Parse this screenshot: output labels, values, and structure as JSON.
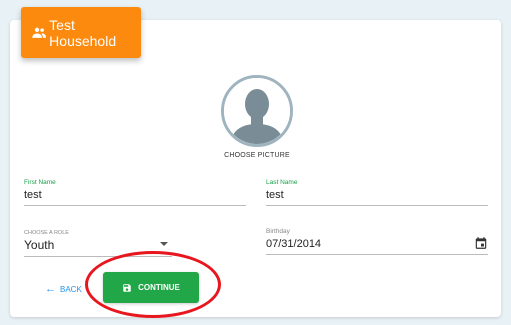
{
  "header": {
    "title": "Test Household",
    "icon": "group-icon",
    "color": "#fb8a0e"
  },
  "avatar": {
    "choose_label": "CHOOSE PICTURE"
  },
  "form": {
    "first_name": {
      "label": "First Name",
      "value": "test"
    },
    "last_name": {
      "label": "Last Name",
      "value": "test"
    },
    "role": {
      "label": "CHOOSE A ROLE",
      "value": "Youth"
    },
    "birthday": {
      "label": "Birthday",
      "value": "07/31/2014"
    }
  },
  "actions": {
    "back_label": "BACK",
    "continue_label": "CONTINUE",
    "continue_color": "#21a648"
  }
}
